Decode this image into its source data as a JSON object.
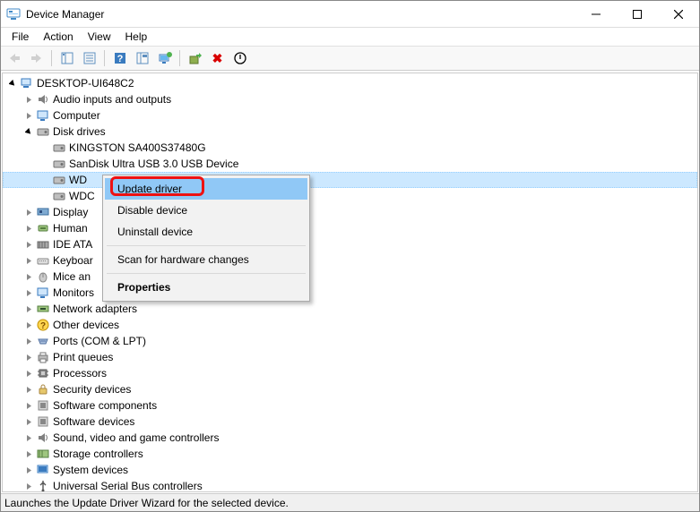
{
  "window": {
    "title": "Device Manager"
  },
  "menu": {
    "file": "File",
    "action": "Action",
    "view": "View",
    "help": "Help"
  },
  "tree": {
    "root": "DESKTOP-UI648C2",
    "audio": "Audio inputs and outputs",
    "computer": "Computer",
    "disk_drives": "Disk drives",
    "disk_kingston": "KINGSTON SA400S37480G",
    "disk_sandisk": "SanDisk Ultra USB 3.0 USB Device",
    "disk_wd": "WD",
    "disk_wdc": "WDC",
    "display": "Display",
    "hid": "Human",
    "ide": "IDE ATA",
    "keyboards": "Keyboar",
    "mice": "Mice an",
    "monitors": "Monitors",
    "network": "Network adapters",
    "other": "Other devices",
    "ports": "Ports (COM & LPT)",
    "print_queues": "Print queues",
    "processors": "Processors",
    "security": "Security devices",
    "sw_components": "Software components",
    "sw_devices": "Software devices",
    "sound": "Sound, video and game controllers",
    "storage_ctrl": "Storage controllers",
    "system": "System devices",
    "usb": "Universal Serial Bus controllers"
  },
  "context_menu": {
    "update_driver": "Update driver",
    "disable_device": "Disable device",
    "uninstall_device": "Uninstall device",
    "scan": "Scan for hardware changes",
    "properties": "Properties"
  },
  "status": {
    "text": "Launches the Update Driver Wizard for the selected device."
  }
}
